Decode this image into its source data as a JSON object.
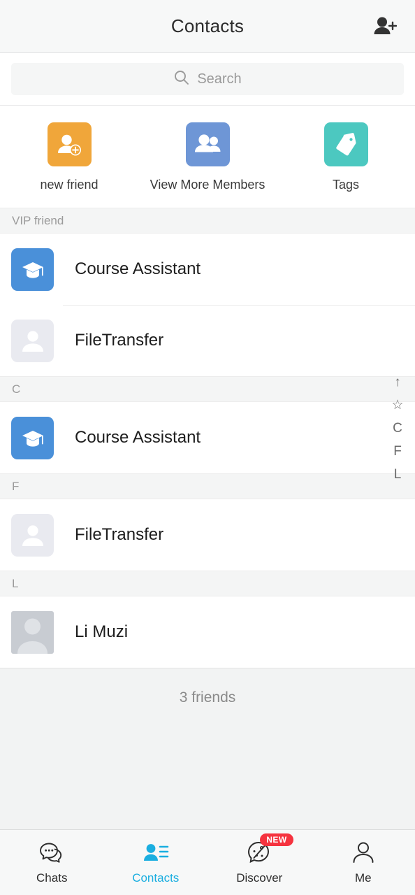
{
  "header": {
    "title": "Contacts",
    "action_icon": "add-contact-icon"
  },
  "search": {
    "placeholder": "Search",
    "icon": "search-icon",
    "value": ""
  },
  "quick_actions": [
    {
      "label": "new friend",
      "icon": "person-add-icon",
      "color": "#F0A63A"
    },
    {
      "label": "View More Members",
      "icon": "group-icon",
      "color": "#6E96D6"
    },
    {
      "label": "Tags",
      "icon": "tag-icon",
      "color": "#4CC8C0"
    }
  ],
  "sections": [
    {
      "header": "VIP friend",
      "contacts": [
        {
          "name": "Course Assistant",
          "avatar": "graduation-cap-avatar",
          "avatar_color": "#4A90D9"
        },
        {
          "name": "FileTransfer",
          "avatar": "default-person-avatar",
          "avatar_color": "#E9EAF0"
        }
      ]
    },
    {
      "header": "C",
      "contacts": [
        {
          "name": "Course Assistant",
          "avatar": "graduation-cap-avatar",
          "avatar_color": "#4A90D9"
        }
      ]
    },
    {
      "header": "F",
      "contacts": [
        {
          "name": "FileTransfer",
          "avatar": "default-person-avatar",
          "avatar_color": "#E9EAF0"
        }
      ]
    },
    {
      "header": "L",
      "contacts": [
        {
          "name": "Li Muzi",
          "avatar": "grey-person-avatar",
          "avatar_color": "#C8CCD2"
        }
      ]
    }
  ],
  "alpha_index": [
    "↑",
    "☆",
    "C",
    "F",
    "L"
  ],
  "friend_count": "3 friends",
  "tabs": [
    {
      "label": "Chats",
      "icon": "chat-bubbles-icon",
      "active": false,
      "badge": ""
    },
    {
      "label": "Contacts",
      "icon": "contacts-icon",
      "active": true,
      "badge": ""
    },
    {
      "label": "Discover",
      "icon": "discover-icon",
      "active": false,
      "badge": "NEW"
    },
    {
      "label": "Me",
      "icon": "person-icon",
      "active": false,
      "badge": ""
    }
  ],
  "colors": {
    "accent": "#1AAEE0",
    "badge_red": "#F5333F",
    "page_bg": "#F2F3F3"
  }
}
